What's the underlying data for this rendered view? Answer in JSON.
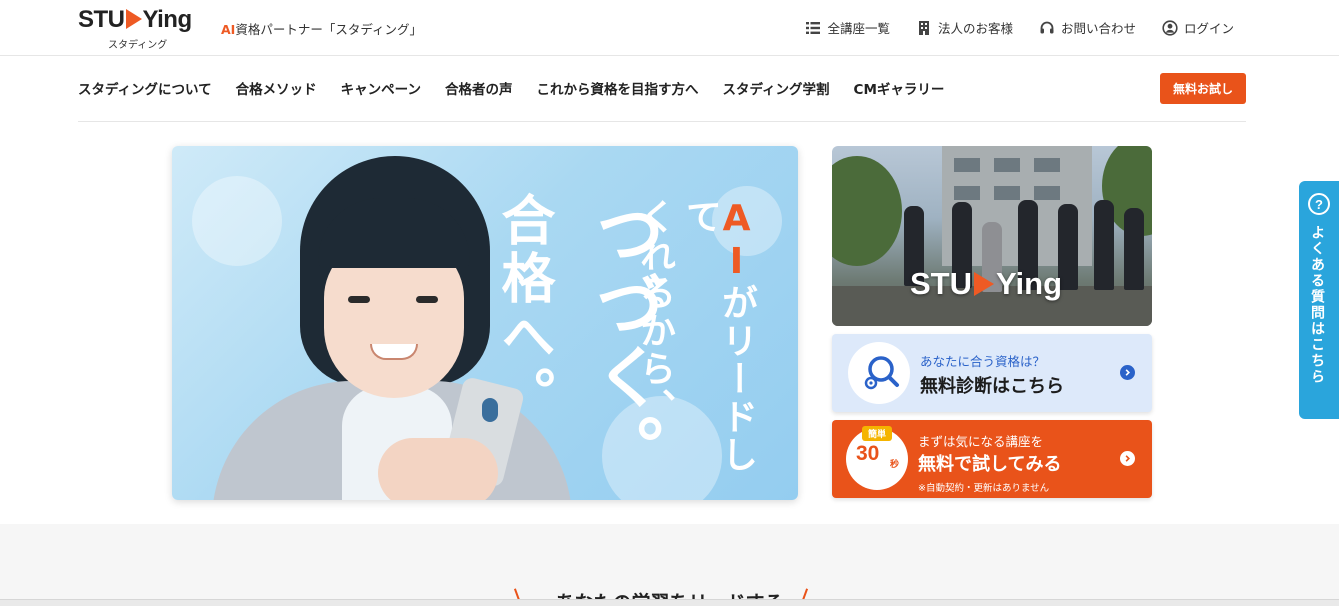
{
  "header": {
    "logo_text": "STUDYing",
    "logo_subtitle": "スタディング",
    "tagline_ai": "AI",
    "tagline_rest": "資格パートナー「スタディング」",
    "util_nav": [
      {
        "label": "全講座一覧",
        "icon": "list-icon"
      },
      {
        "label": "法人のお客様",
        "icon": "building-icon"
      },
      {
        "label": "お問い合わせ",
        "icon": "headset-icon"
      },
      {
        "label": "ログイン",
        "icon": "user-icon"
      }
    ]
  },
  "main_nav": {
    "items": [
      "スタディングについて",
      "合格メソッド",
      "キャンペーン",
      "合格者の声",
      "これから資格を目指す方へ",
      "スタディング学割",
      "CMギャラリー"
    ],
    "trial_button": "無料お試し"
  },
  "hero": {
    "col1_ai": "AI",
    "col1_rest": "がリードして",
    "col2": "くれるから、",
    "col3": "つづく。",
    "col4": "合格へ。"
  },
  "side": {
    "photo_logo": "STUDYing",
    "diagnosis": {
      "lead": "あなたに合う資格は？",
      "main": "無料診断はこちら"
    },
    "trial": {
      "badge": "簡単",
      "seconds": "30",
      "unit": "秒",
      "lead": "まずは気になる講座を",
      "main": "無料で試してみる",
      "note": "※自動契約・更新はありません"
    }
  },
  "faq_tab": {
    "icon": "question-icon",
    "label": "よくある質問はこちら"
  },
  "lower": {
    "heading": "あなたの学習をリードする"
  },
  "colors": {
    "brand_orange": "#e9531a",
    "faq_blue": "#2aa5dc",
    "diagnosis_bg": "#dde9fa",
    "diagnosis_text": "#2a62c9"
  }
}
